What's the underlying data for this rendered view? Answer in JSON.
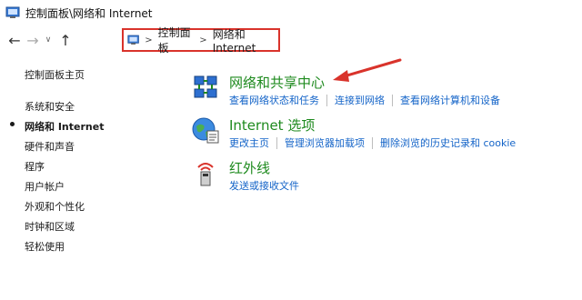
{
  "window": {
    "title": "控制面板\\网络和 Internet"
  },
  "nav": {
    "back_glyph": "←",
    "forward_glyph": "→",
    "dropdown_glyph": "∨",
    "up_glyph": "↑",
    "breadcrumb": [
      "控制面板",
      "网络和 Internet"
    ],
    "breadcrumb_sep": ">"
  },
  "sidebar": {
    "home": "控制面板主页",
    "items": [
      {
        "label": "系统和安全",
        "active": false
      },
      {
        "label": "网络和 Internet",
        "active": true
      },
      {
        "label": "硬件和声音",
        "active": false
      },
      {
        "label": "程序",
        "active": false
      },
      {
        "label": "用户帐户",
        "active": false
      },
      {
        "label": "外观和个性化",
        "active": false
      },
      {
        "label": "时钟和区域",
        "active": false
      },
      {
        "label": "轻松使用",
        "active": false
      }
    ]
  },
  "categories": [
    {
      "icon": "network-sharing-icon",
      "title": "网络和共享中心",
      "links": [
        "查看网络状态和任务",
        "连接到网络",
        "查看网络计算机和设备"
      ]
    },
    {
      "icon": "internet-options-icon",
      "title": "Internet 选项",
      "links": [
        "更改主页",
        "管理浏览器加载项",
        "删除浏览的历史记录和 cookie"
      ]
    },
    {
      "icon": "infrared-icon",
      "title": "红外线",
      "links": [
        "发送或接收文件"
      ]
    }
  ],
  "colors": {
    "category_title": "#1e8a1e",
    "link": "#1464c8",
    "annotation_red": "#d9332b"
  }
}
